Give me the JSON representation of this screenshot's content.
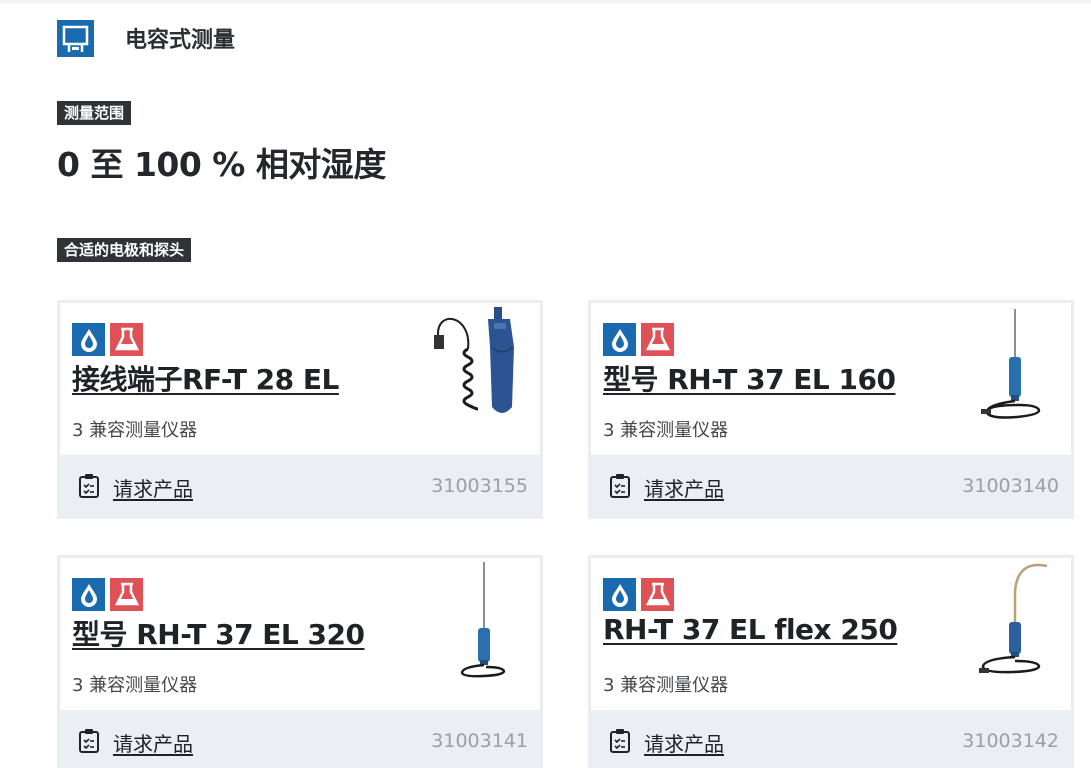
{
  "header": {
    "title": "电容式测量",
    "icon": "capacitive-sensor-icon",
    "accent": "#1a6ab0"
  },
  "range": {
    "label": "测量范围",
    "value": "0 至 100 % 相对湿度"
  },
  "probes": {
    "label": "合适的电极和探头",
    "cards": [
      {
        "title": "接线端子RF-T 28 EL",
        "subtitle": "3 兼容测量仪器",
        "request_label": "请求产品",
        "article_no": "31003155",
        "image": "handheld-probe-with-coiled-cable"
      },
      {
        "title": "型号 RH-T 37 EL 160",
        "subtitle": "3 兼容测量仪器",
        "request_label": "请求产品",
        "article_no": "31003140",
        "image": "short-needle-probe"
      },
      {
        "title": "型号 RH-T 37 EL 320",
        "subtitle": "3 兼容测量仪器",
        "request_label": "请求产品",
        "article_no": "31003141",
        "image": "long-needle-probe"
      },
      {
        "title": "RH-T 37 EL flex 250",
        "subtitle": "3 兼容测量仪器",
        "request_label": "请求产品",
        "article_no": "31003142",
        "image": "flexible-gooseneck-probe"
      }
    ],
    "badges": [
      "humidity-drop-icon",
      "lab-flask-icon"
    ],
    "colors": {
      "badge_blue": "#1a6ab0",
      "badge_red": "#e05157",
      "footer_bg": "#ebeef3"
    }
  }
}
